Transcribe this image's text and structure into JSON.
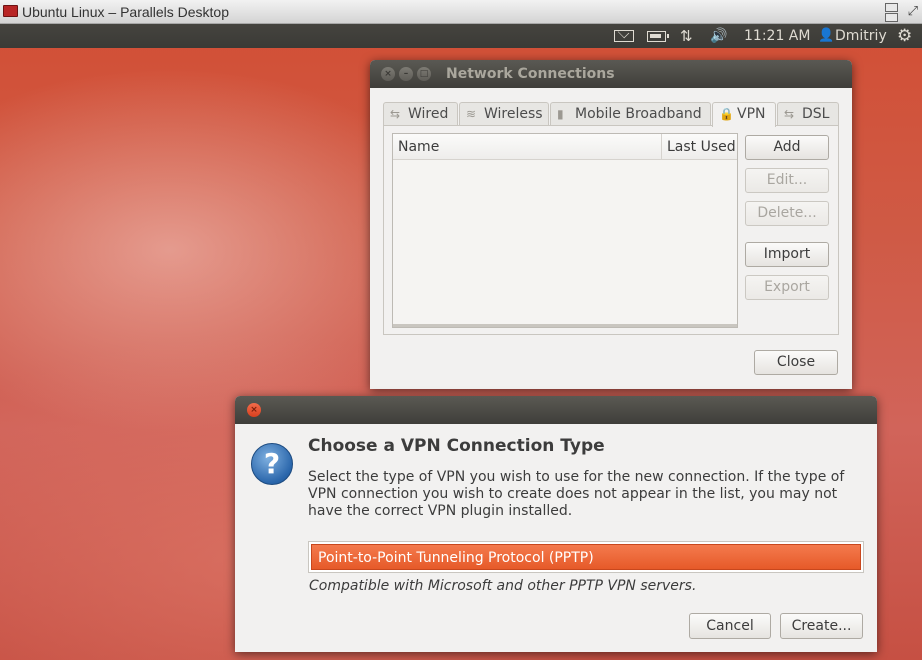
{
  "host": {
    "title": "Ubuntu Linux – Parallels Desktop",
    "fullscreen_glyph": "⤢"
  },
  "panel": {
    "icons": [
      "mail-icon",
      "battery-icon",
      "network-icon",
      "volume-icon",
      "user-icon",
      "gear-icon"
    ],
    "network_glyph": "⇅",
    "volume_glyph": "🔊",
    "clock": "11:21 AM",
    "user_glyph": "👤",
    "user": "Dmitriy",
    "gear_glyph": "⚙"
  },
  "network_connections": {
    "title": "Network Connections",
    "tabs": [
      {
        "label": "Wired",
        "icon": "wired-icon",
        "glyph": "⇆"
      },
      {
        "label": "Wireless",
        "icon": "wireless-icon",
        "glyph": "≋"
      },
      {
        "label": "Mobile Broadband",
        "icon": "mobile-broadband-icon",
        "glyph": "▮"
      },
      {
        "label": "VPN",
        "icon": "lock-icon",
        "glyph": "🔒"
      },
      {
        "label": "DSL",
        "icon": "dsl-icon",
        "glyph": "⇆"
      }
    ],
    "active_tab": "VPN",
    "columns": [
      "Name",
      "Last Used"
    ],
    "buttons": {
      "add": "Add",
      "edit": "Edit...",
      "delete": "Delete...",
      "import": "Import",
      "export": "Export",
      "close": "Close"
    }
  },
  "vpn_dialog": {
    "heading": "Choose a VPN Connection Type",
    "description": "Select the type of VPN you wish to use for the new connection.  If the type of VPN connection you wish to create does not appear in the list, you may not have the correct VPN plugin installed.",
    "selected_type": "Point-to-Point Tunneling Protocol (PPTP)",
    "compat_note": "Compatible with Microsoft and other PPTP VPN servers.",
    "help_glyph": "?",
    "buttons": {
      "cancel": "Cancel",
      "create": "Create..."
    }
  },
  "colors": {
    "accent_orange": "#e65a29",
    "titlebar_dark": "#3f3e3a",
    "desktop_red": "#d24e34"
  }
}
